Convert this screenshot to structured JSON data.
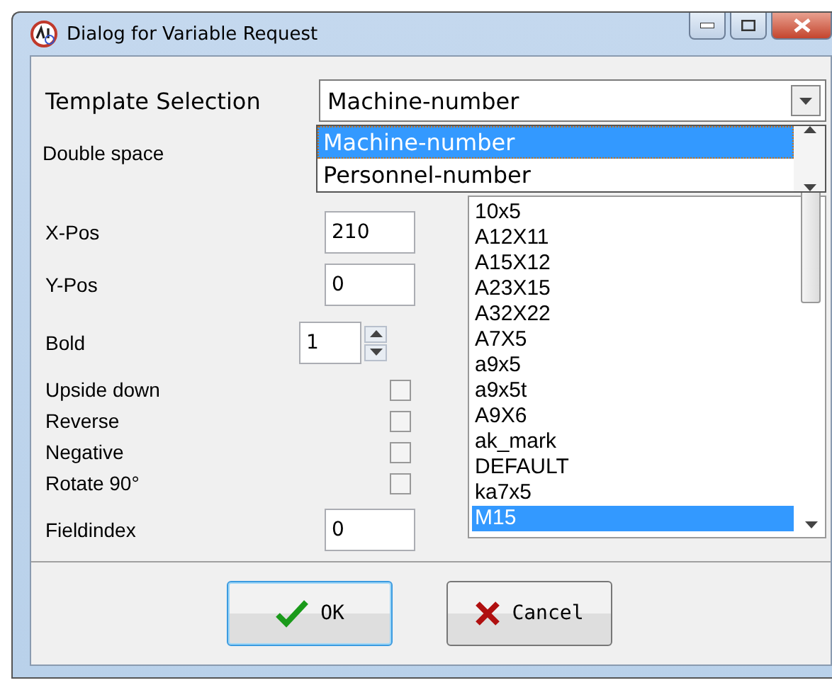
{
  "window": {
    "title": "Dialog for Variable Request"
  },
  "template": {
    "label": "Template Selection",
    "value": "Machine-number",
    "expanded": true,
    "options": [
      {
        "label": "Machine-number",
        "selected": true
      },
      {
        "label": "Personnel-number",
        "selected": false
      }
    ]
  },
  "double_space": {
    "label": "Double space"
  },
  "fields": [
    {
      "kind": "text",
      "label": "X-Pos",
      "value": "210"
    },
    {
      "kind": "text",
      "label": "Y-Pos",
      "value": "0"
    },
    {
      "kind": "spin",
      "label": "Bold",
      "value": "1"
    },
    {
      "kind": "check",
      "label": "Upside down",
      "checked": false
    },
    {
      "kind": "check",
      "label": "Reverse",
      "checked": false
    },
    {
      "kind": "check",
      "label": "Negative",
      "checked": false
    },
    {
      "kind": "check",
      "label": "Rotate 90°",
      "checked": false
    },
    {
      "kind": "text",
      "label": "Fieldindex",
      "value": "0"
    }
  ],
  "fonts": [
    {
      "label": "10x5",
      "selected": false
    },
    {
      "label": "A12X11",
      "selected": false
    },
    {
      "label": "A15X12",
      "selected": false
    },
    {
      "label": "A23X15",
      "selected": false
    },
    {
      "label": "A32X22",
      "selected": false
    },
    {
      "label": "A7X5",
      "selected": false
    },
    {
      "label": "a9x5",
      "selected": false
    },
    {
      "label": "a9x5t",
      "selected": false
    },
    {
      "label": "A9X6",
      "selected": false
    },
    {
      "label": "ak_mark",
      "selected": false
    },
    {
      "label": "DEFAULT",
      "selected": false
    },
    {
      "label": "ka7x5",
      "selected": false
    },
    {
      "label": "M15",
      "selected": true
    }
  ],
  "buttons": [
    {
      "kind": "ok",
      "label": "OK",
      "selected": true
    },
    {
      "kind": "cancel",
      "label": "Cancel",
      "selected": false
    }
  ]
}
